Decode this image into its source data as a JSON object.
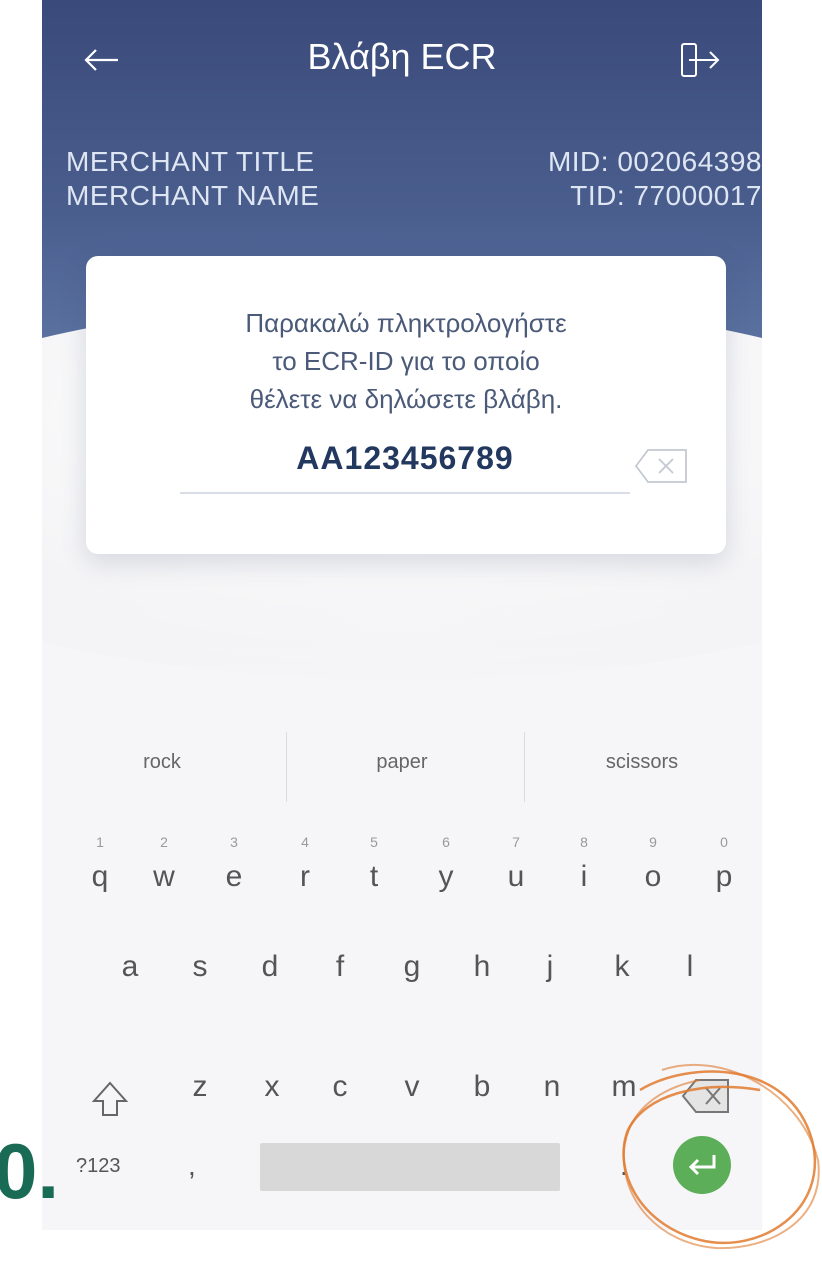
{
  "header": {
    "title": "Βλάβη ECR",
    "back_icon": "arrow-left-icon",
    "exit_icon": "logout-icon",
    "merchant_title": "MERCHANT TITLE",
    "merchant_name": "MERCHANT NAME",
    "mid": "MID: 002064398",
    "tid": "TID: 77000017"
  },
  "dialog": {
    "prompt_line1": "Παρακαλώ πληκτρολογήστε",
    "prompt_line2": "το ECR-ID για το οποίο",
    "prompt_line3": "θέλετε να δηλώσετε βλάβη.",
    "ecr_id_value": "AA123456789",
    "clear_icon": "backspace-clear-icon"
  },
  "keyboard": {
    "suggestions": [
      "rock",
      "paper",
      "scissors"
    ],
    "row1": [
      {
        "hint": "1",
        "key": "q"
      },
      {
        "hint": "2",
        "key": "w"
      },
      {
        "hint": "3",
        "key": "e"
      },
      {
        "hint": "4",
        "key": "r"
      },
      {
        "hint": "5",
        "key": "t"
      },
      {
        "hint": "6",
        "key": "y"
      },
      {
        "hint": "7",
        "key": "u"
      },
      {
        "hint": "8",
        "key": "i"
      },
      {
        "hint": "9",
        "key": "o"
      },
      {
        "hint": "0",
        "key": "p"
      }
    ],
    "row2": [
      "a",
      "s",
      "d",
      "f",
      "g",
      "h",
      "j",
      "k",
      "l"
    ],
    "row3": [
      "z",
      "x",
      "c",
      "v",
      "b",
      "n",
      "m"
    ],
    "symbols_label": "?123",
    "comma_label": ",",
    "period_label": ".",
    "enter_color": "#5cae58"
  },
  "annotation": {
    "step_label": "0.",
    "highlight_color": "#e07a2e"
  },
  "colors": {
    "header_top": "#3a4a7a",
    "header_bottom": "#6b86b3",
    "id_text": "#23385f"
  }
}
